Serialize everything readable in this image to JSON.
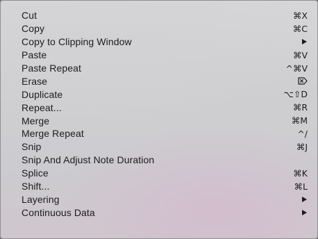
{
  "menu": {
    "items": [
      {
        "label": "Cut",
        "shortcut": "⌘X"
      },
      {
        "label": "Copy",
        "shortcut": "⌘C"
      },
      {
        "label": "Copy to Clipping Window",
        "submenu": true
      },
      {
        "label": "Paste",
        "shortcut": "⌘V"
      },
      {
        "label": "Paste Repeat",
        "shortcut": "^⌘V"
      },
      {
        "label": "Erase",
        "icon": "delete-forward-icon"
      },
      {
        "label": "Duplicate",
        "shortcut": "⌥⇧D"
      },
      {
        "label": "Repeat...",
        "shortcut": "⌘R"
      },
      {
        "label": "Merge",
        "shortcut": "⌘M"
      },
      {
        "label": "Merge Repeat",
        "shortcut": "^/"
      },
      {
        "label": "Snip",
        "shortcut": "⌘J"
      },
      {
        "label": "Snip And Adjust Note Duration"
      },
      {
        "label": "Splice",
        "shortcut": "⌘K"
      },
      {
        "label": "Shift...",
        "shortcut": "⌘L"
      },
      {
        "label": "Layering",
        "submenu": true
      },
      {
        "label": "Continuous Data",
        "submenu": true
      }
    ]
  }
}
